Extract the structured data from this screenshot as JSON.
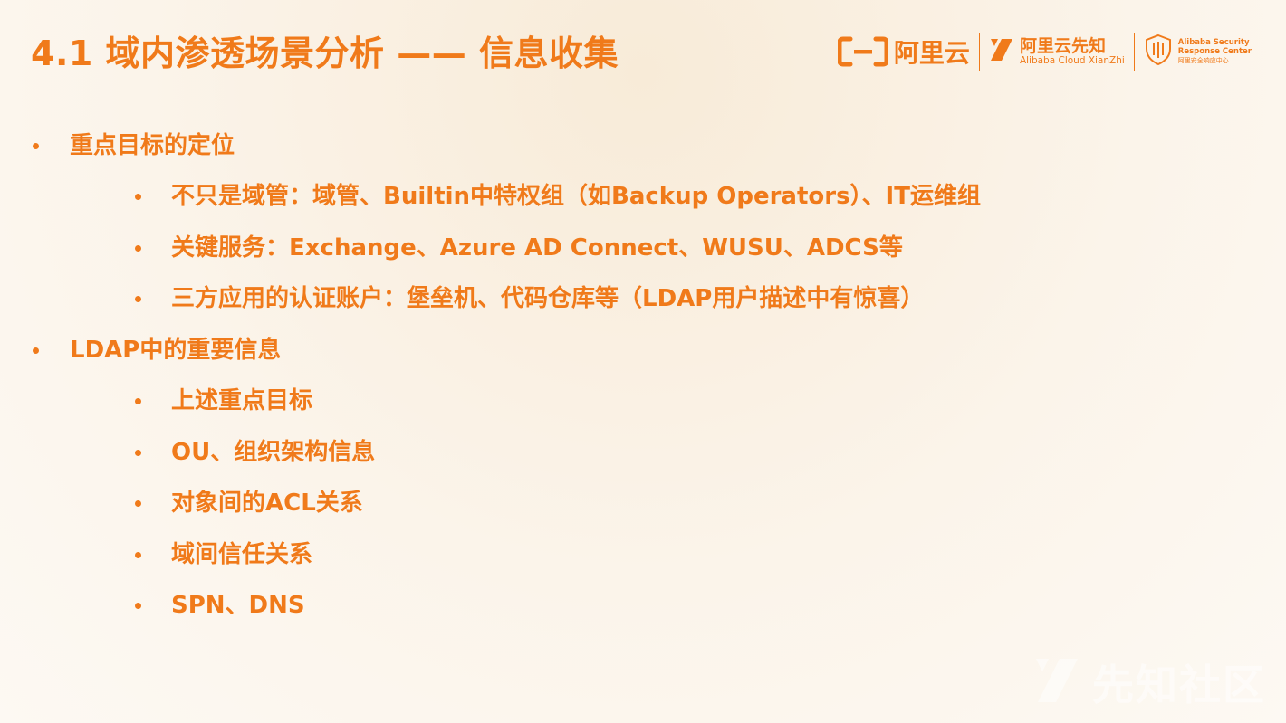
{
  "slide": {
    "title": "4.1 域内渗透场景分析 —— 信息收集"
  },
  "logos": {
    "aliyun": {
      "word": "阿里云",
      "icon": "aliyun-bracket-logo"
    },
    "xianzhi": {
      "cn": "阿里云先知",
      "en": "Alibaba Cloud XianZhi",
      "icon": "xianzhi-logo"
    },
    "asrc": {
      "line1": "Alibaba Security",
      "line2": "Response Center",
      "line3": "阿里安全响应中心",
      "icon": "shield-logo"
    }
  },
  "bullets": [
    {
      "level": 1,
      "text": "重点目标的定位"
    },
    {
      "level": 2,
      "text": "不只是域管：域管、Builtin中特权组（如Backup Operators）、IT运维组"
    },
    {
      "level": 2,
      "text": "关键服务：Exchange、Azure AD Connect、WUSU、ADCS等"
    },
    {
      "level": 2,
      "text": "三方应用的认证账户：堡垒机、代码仓库等（LDAP用户描述中有惊喜）"
    },
    {
      "level": 1,
      "text": "LDAP中的重要信息"
    },
    {
      "level": 2,
      "text": "上述重点目标"
    },
    {
      "level": 2,
      "text": "OU、组织架构信息"
    },
    {
      "level": 2,
      "text": "对象间的ACL关系"
    },
    {
      "level": 2,
      "text": "域间信任关系"
    },
    {
      "level": 2,
      "text": "SPN、DNS"
    }
  ],
  "watermark": {
    "text": "先知社区",
    "icon": "xianzhi-watermark-logo"
  },
  "colors": {
    "accent": "#f07a1a",
    "background": "#fbf4ea"
  }
}
